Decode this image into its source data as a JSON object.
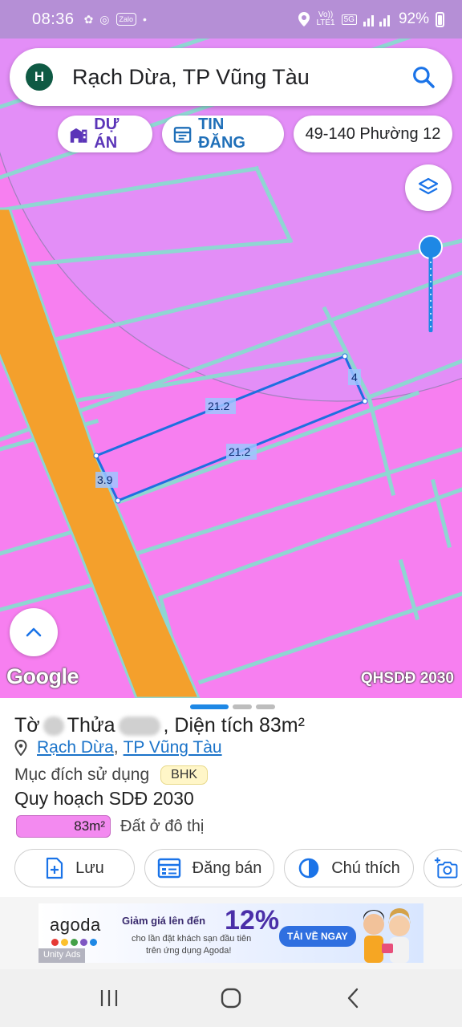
{
  "status_bar": {
    "time": "08:36",
    "app_icons": [
      "pinwheel-icon",
      "chrome-icon",
      "zalo-icon",
      "dot-icon"
    ],
    "zalo_label": "Zalo",
    "network_top": "Vo))",
    "network_bottom": "LTE1",
    "network_5g": "5G",
    "battery": "92%"
  },
  "search": {
    "avatar_letter": "H",
    "query": "Rạch Dừa, TP Vũng Tàu"
  },
  "chips": {
    "project": "DỰ ÁN",
    "listing": "TIN ĐĂNG",
    "parcel": "49-140 Phường 12"
  },
  "map": {
    "dimensions": {
      "top_edge": "21.2",
      "bottom_edge": "21.2",
      "left_edge": "3.9",
      "right_edge": "4"
    },
    "google_logo": "Google",
    "layer_label": "QHSDĐ 2030",
    "colors": {
      "urban_land": "#f77ff0",
      "road": "#f4a02c",
      "boundary": "#8fd6d2",
      "parcel_outline": "#1e6fe0",
      "radius_overlay": "#c8a8ff"
    }
  },
  "sheet": {
    "to_label": "Tờ",
    "thua_label": "Thửa",
    "area_text": ", Diện tích 83m²",
    "location_link_1": "Rạch Dừa",
    "location_sep": ",",
    "location_link_2": "TP Vũng Tàu",
    "purpose_label": "Mục đích sử dụng",
    "purpose_code": "BHK",
    "plan_title": "Quy hoạch SDĐ 2030",
    "legend_area": "83m²",
    "legend_label": "Đất ở đô thị",
    "actions": {
      "save": "Lưu",
      "post": "Đăng bán",
      "legend": "Chú thích"
    }
  },
  "ad": {
    "brand": "agoda",
    "headline": "Giảm giá lên đến",
    "percent": "12%",
    "sub1": "cho lần đặt khách sạn đầu tiên",
    "sub2": "trên ứng dụng Agoda!",
    "cta": "TẢI VỀ NGAY",
    "unity": "Unity Ads",
    "dot_colors": [
      "#e53935",
      "#fbc02d",
      "#43a047",
      "#7e57c2",
      "#1e88e5"
    ]
  }
}
